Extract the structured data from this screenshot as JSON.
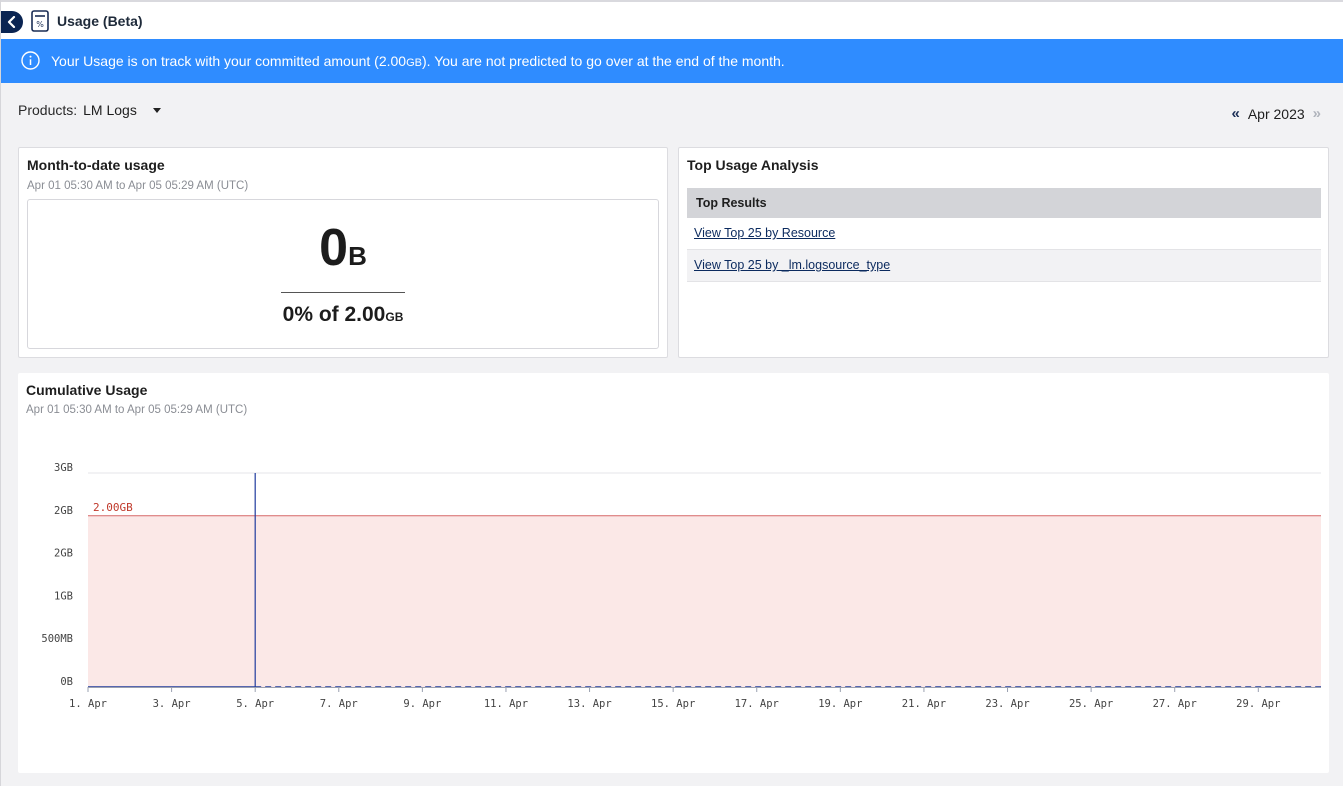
{
  "header": {
    "title": "Usage (Beta)"
  },
  "banner": {
    "text_pre": "Your Usage is on track with your committed amount (2.00",
    "text_unit": "GB",
    "text_post": "). You are not predicted to go over at the end of the month."
  },
  "products": {
    "label": "Products:",
    "value": "LM Logs"
  },
  "month_nav": {
    "month": "Apr 2023"
  },
  "mtd": {
    "title": "Month-to-date usage",
    "range": "Apr 01 05:30 AM to Apr 05 05:29 AM (UTC)",
    "value": "0",
    "value_unit": "B",
    "pct_text": "0% of 2.00",
    "pct_unit": "GB"
  },
  "top_usage": {
    "title": "Top Usage Analysis",
    "results_header": "Top Results",
    "results": [
      "View Top 25 by Resource",
      "View Top 25 by _lm.logsource_type"
    ]
  },
  "cumulative": {
    "title": "Cumulative Usage",
    "range": "Apr 01 05:30 AM to Apr 05 05:29 AM (UTC)"
  },
  "colors": {
    "banner": "#2f8cff",
    "commit_line": "#d96b6b",
    "commit_fill": "#fbe8e7",
    "series": "#1f3a9e",
    "link": "#0b2a5e"
  },
  "chart_data": {
    "type": "area",
    "ylabel_ticks": [
      "0B",
      "500MB",
      "1GB",
      "2GB",
      "2GB",
      "3GB"
    ],
    "y_tick_values_gb": [
      0,
      0.5,
      1,
      1.5,
      2,
      2.5
    ],
    "ylim_gb": [
      0,
      2.5
    ],
    "x_ticks": [
      "1. Apr",
      "3. Apr",
      "5. Apr",
      "7. Apr",
      "9. Apr",
      "11. Apr",
      "13. Apr",
      "15. Apr",
      "17. Apr",
      "19. Apr",
      "21. Apr",
      "23. Apr",
      "25. Apr",
      "27. Apr",
      "29. Apr"
    ],
    "x_tick_days": [
      1,
      3,
      5,
      7,
      9,
      11,
      13,
      15,
      17,
      19,
      21,
      23,
      25,
      27,
      29
    ],
    "xlim_days": [
      1,
      30.5
    ],
    "commit": {
      "label": "2.00GB",
      "value_gb": 2.0
    },
    "current_day": 5,
    "series": [
      {
        "style": "solid",
        "x": [
          1,
          5
        ],
        "y": [
          0,
          0
        ]
      },
      {
        "style": "dashed",
        "x": [
          5,
          30.5
        ],
        "y": [
          0,
          0
        ]
      }
    ],
    "grid": true
  }
}
